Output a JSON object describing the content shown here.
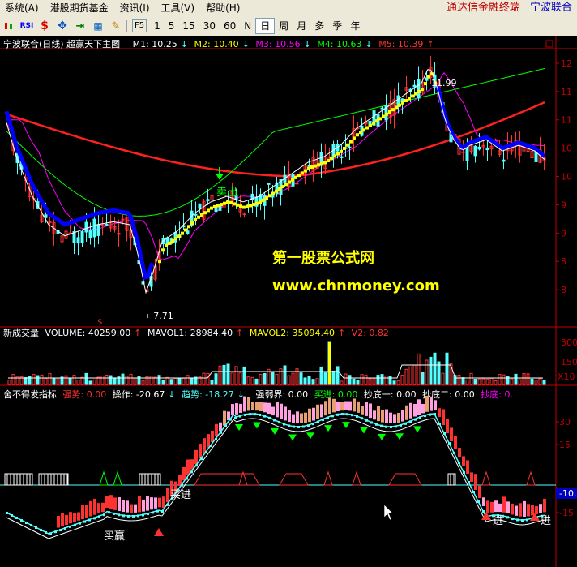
{
  "menu": {
    "items": [
      "系统(A)",
      "港股期货基金",
      "资讯(I)",
      "工具(V)",
      "帮助(H)"
    ],
    "periods": [
      "1",
      "5",
      "15",
      "30",
      "60",
      "N",
      "日",
      "周",
      "月",
      "多",
      "季",
      "年"
    ],
    "active_period": "日",
    "toolbar_f5": "F5",
    "toolbar_rsi": "RSI",
    "brand_title": "通达信金融终端",
    "brand_stock": "宁波联合"
  },
  "main_chart": {
    "title": "宁波联合(日线) 超赢天下主图",
    "ma": [
      {
        "label": "M1: 10.25",
        "color": "#ffffff"
      },
      {
        "label": "M2: 10.40",
        "color": "#ffff00"
      },
      {
        "label": "M3: 10.56",
        "color": "#ff00ff"
      },
      {
        "label": "M4: 10.63",
        "color": "#00ff00"
      },
      {
        "label": "M5: 10.39",
        "color": "#ff3030"
      }
    ],
    "price_labels": [
      "12",
      "11",
      "11",
      "10",
      "10",
      "9",
      "9",
      "8",
      "8"
    ],
    "high_label": "11.99",
    "low_label": "←7.71",
    "sell_label": "卖出",
    "watermark_title": "第一股票公式网",
    "watermark_url": "www.chnmoney.com"
  },
  "volume_chart": {
    "name": "新成交量",
    "volume": "VOLUME: 40259.00",
    "mavol1": "MAVOL1: 28984.40",
    "mavol2": "MAVOL2: 35094.40",
    "v2": "V2: 0.82",
    "scale_top": "300",
    "scale_mid": "150",
    "scale_unit": "X10"
  },
  "indicator_chart": {
    "name": "舍不得发指标",
    "strong": "强势: 0.00",
    "operate": "操作: -20.67",
    "trend": "趋势: -18.27",
    "strong_weak": "强弱界: 0.00",
    "buy_in": "买进: 0.00",
    "bottom1": "抄底一: 0.00",
    "bottom2": "抄底二: 0.00",
    "bottom": "抄底: 0.",
    "scale_30": "30",
    "scale_15": "15",
    "scale_neg_105": "-10.5",
    "scale_neg_15": "-15",
    "buy_label": "买进",
    "buy_win_label": "买赢",
    "in_label_1": "进",
    "in_label_2": "进"
  },
  "colors": {
    "up": "#ff3232",
    "down": "#54ffff",
    "ma1": "#ffffff",
    "ma2": "#ffff00",
    "ma3": "#ff00ff",
    "ma4": "#00ff00",
    "ma5": "#ff2020",
    "accent_blue": "#0000ff",
    "watermark": "#ffff00"
  }
}
